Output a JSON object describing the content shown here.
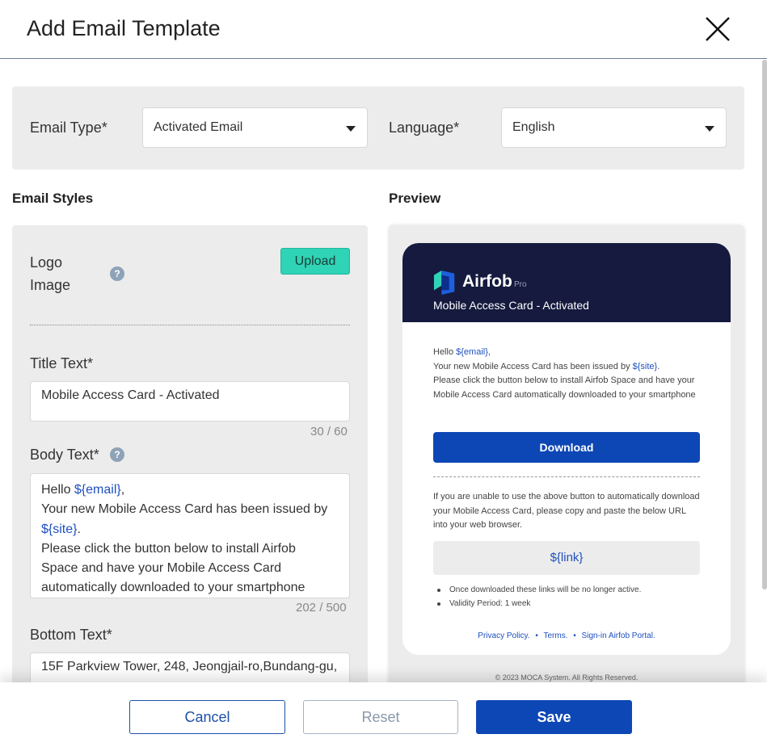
{
  "dialog": {
    "title": "Add Email Template"
  },
  "type_bar": {
    "email_type_label": "Email Type*",
    "email_type_value": "Activated Email",
    "language_label": "Language*",
    "language_value": "English"
  },
  "email_styles": {
    "section_title": "Email Styles",
    "logo_label_line1": "Logo",
    "logo_label_line2": "Image",
    "help_icon": "question-mark-icon",
    "upload_label": "Upload",
    "title_label": "Title Text*",
    "title_value": "Mobile Access Card - Activated",
    "title_counter": "30 / 60",
    "body_label": "Body Text*",
    "body_lines": {
      "hello": "Hello ",
      "email_var": "${email}",
      "comma": ",",
      "line2": "Your new Mobile Access Card has been issued by",
      "site_var": "${site}",
      "period": ".",
      "line4": "Please click the button below to install Airfob",
      "line5": "Space and have your Mobile Access Card",
      "line6": "automatically downloaded to your smartphone"
    },
    "body_counter": "202 / 500",
    "bottom_label": "Bottom Text*",
    "bottom_value": "15F Parkview Tower, 248, Jeongjail-ro,Bundang-gu,"
  },
  "preview": {
    "section_title": "Preview",
    "brand_name": "Airfob",
    "brand_tier": "Pro",
    "card_title": "Mobile Access Card - Activated",
    "body": {
      "hello": "Hello ",
      "email_var": "${email}",
      "comma": ",",
      "line2_prefix": "Your new Mobile Access Card has been issued by ",
      "site_var": "${site}",
      "period": ".",
      "line3": "Please click the button below to install Airfob Space and have your Mobile Access Card automatically downloaded to your smartphone"
    },
    "download_label": "Download",
    "note": "If you are unable to use the above button to automatically download your Mobile Access Card, please copy and paste the below URL into your web browser.",
    "link_var": "${link}",
    "bullets": [
      "Once downloaded these links will be no longer active.",
      "Validity Period: 1 week"
    ],
    "footer_links": [
      "Privacy Policy.",
      "Terms.",
      "Sign-in Airfob Portal."
    ],
    "footer_separator": "•",
    "copyright": "© 2023 MOCA System. All Rights Reserved."
  },
  "actions": {
    "cancel": "Cancel",
    "reset": "Reset",
    "save": "Save"
  },
  "colors": {
    "primary": "#0d47b5",
    "accent": "#2fd3b5",
    "header_dark": "#151a3e",
    "panel": "#ececec"
  }
}
